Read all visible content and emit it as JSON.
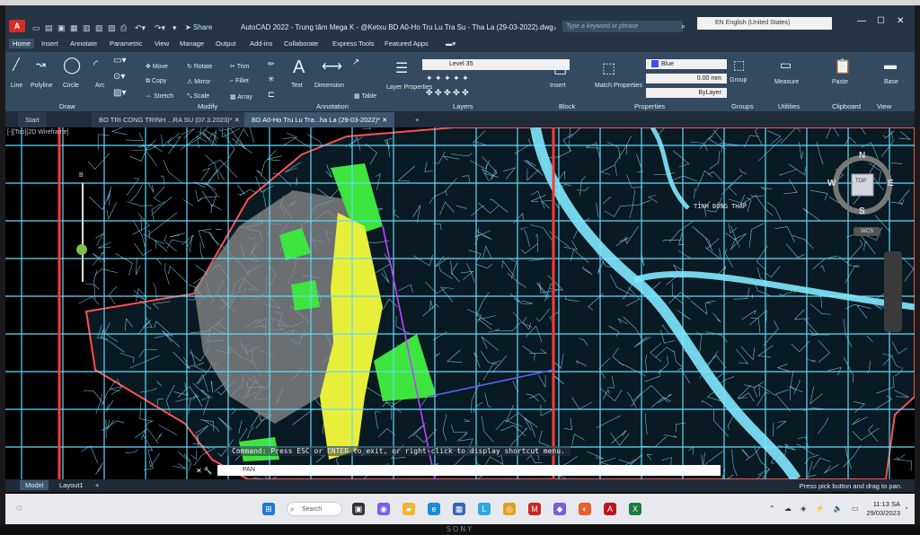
{
  "window": {
    "title": "AutoCAD 2022 - Trung tâm Mega K - @Ketxu    BD A0-Ho Tru Lu Tra Su - Tha La (29-03-2022).dwg",
    "share_label": "Share",
    "search_placeholder": "Type a keyword or phrase",
    "language": "EN English (United States)"
  },
  "ribbon_tabs": [
    "Home",
    "Insert",
    "Annotate",
    "Parametric",
    "View",
    "Manage",
    "Output",
    "Add-ins",
    "Collaborate",
    "Express Tools",
    "Featured Apps"
  ],
  "ribbon": {
    "draw": {
      "title": "Draw",
      "tools": [
        "Line",
        "Polyline",
        "Circle",
        "Arc"
      ]
    },
    "modify": {
      "title": "Modify",
      "tools": [
        "Move",
        "Rotate",
        "Trim",
        "Copy",
        "Mirror",
        "Fillet",
        "Stretch",
        "Scale",
        "Array"
      ]
    },
    "annotation": {
      "title": "Annotation",
      "tools": [
        "Text",
        "Dimension",
        "Table"
      ]
    },
    "layers": {
      "title": "Layers",
      "tool": "Layer Properties",
      "current_layer": "Level 35"
    },
    "block": {
      "title": "Block",
      "tool": "Insert"
    },
    "properties": {
      "title": "Properties",
      "tool": "Match Properties",
      "color": "Blue",
      "lineweight": "0.00 mm",
      "linetype": "ByLayer"
    },
    "groups": {
      "title": "Groups",
      "tool": "Group"
    },
    "utilities": {
      "title": "Utilities",
      "tool": "Measure"
    },
    "clipboard": {
      "title": "Clipboard",
      "tool": "Paste"
    },
    "view": {
      "title": "View",
      "tool": "Base"
    }
  },
  "doc_tabs": [
    "Start",
    "BO TRI CONG TRINH ...RA SU (07.3.2023)*",
    "BD A0-Ho Tru Lu Tra...ha La (29-03-2022)*"
  ],
  "viewport": {
    "label": "[-][Top][2D Wireframe]",
    "map_label": "TỈNH ĐỒNG THÁP",
    "compass": {
      "n": "N",
      "s": "S",
      "e": "E",
      "w": "W",
      "top": "TOP"
    },
    "wcs": "WCS",
    "north_arrow": "B"
  },
  "command": {
    "history": "Press ESC or ENTER to exit, or right-click to display shortcut menu.",
    "current": "PAN",
    "history_header": "Command:"
  },
  "layout_tabs": [
    "Model",
    "Layout1"
  ],
  "status_message": "Press pick button and drag to pan.",
  "taskbar": {
    "search": "Search",
    "time": "11:13 SA",
    "date": "29/03/2023"
  },
  "monitor_brand": "SONY",
  "colors": {
    "grid": "#5fd9ff",
    "boundary_red": "#ff3a3a",
    "zone_green": "#3ee53e",
    "zone_yellow": "#e8ef3a",
    "ribbon_bg": "#334a61"
  }
}
